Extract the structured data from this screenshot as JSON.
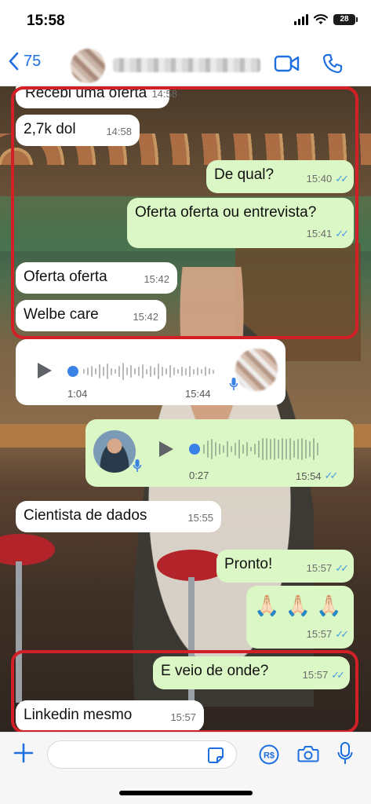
{
  "status": {
    "time": "15:58",
    "battery": "28"
  },
  "header": {
    "back_count": "75"
  },
  "messages": [
    {
      "text": "Recebi uma oferta",
      "time": "14:58"
    },
    {
      "text": "2,7k dol",
      "time": "14:58"
    },
    {
      "text": "De qual?",
      "time": "15:40"
    },
    {
      "text": "Oferta oferta ou entrevista?",
      "time": "15:41"
    },
    {
      "text": "Oferta oferta",
      "time": "15:42"
    },
    {
      "text": "Welbe care",
      "time": "15:42"
    },
    {
      "text": "Cientista de dados",
      "time": "15:55"
    },
    {
      "text": "Pronto!",
      "time": "15:57"
    },
    {
      "text": "🙏🏻 🙏🏻 🙏🏻",
      "time": "15:57"
    },
    {
      "text": "E veio de onde?",
      "time": "15:57"
    },
    {
      "text": "Linkedin mesmo",
      "time": "15:57"
    }
  ],
  "voice_messages": [
    {
      "duration": "1:04",
      "time": "15:44"
    },
    {
      "duration": "0:27",
      "time": "15:54"
    }
  ],
  "colors": {
    "accent": "#1f6fe0",
    "incoming_bubble": "#ffffff",
    "outgoing_bubble": "#dbf7c5",
    "read_ticks": "#4a9be0",
    "highlight": "#d32027"
  },
  "icons": {
    "back": "chevron-left-icon",
    "video": "video-camera-icon",
    "phone": "phone-icon",
    "plus": "plus-icon",
    "sticker": "sticker-icon",
    "pix": "real-currency-icon",
    "camera": "camera-icon",
    "mic": "microphone-icon"
  }
}
